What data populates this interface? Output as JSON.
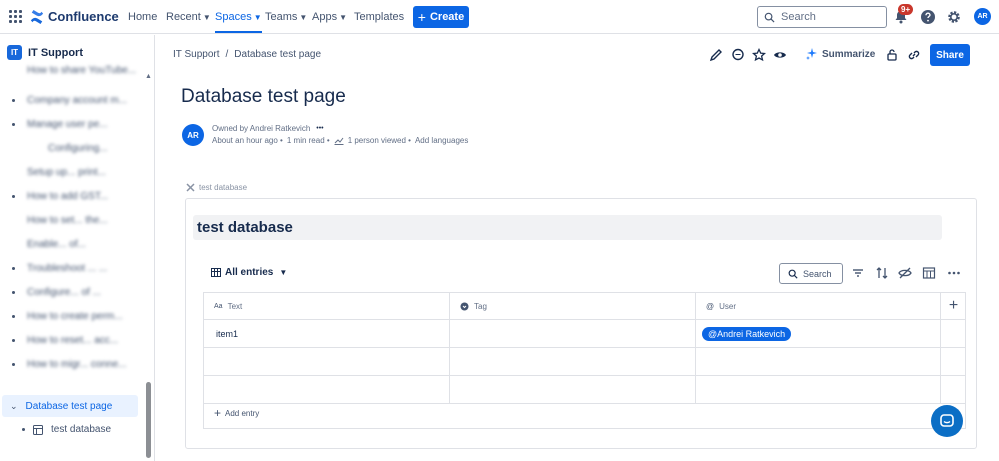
{
  "topnav": {
    "product": "Confluence",
    "items": [
      {
        "label": "Home",
        "has_chevron": false
      },
      {
        "label": "Recent",
        "has_chevron": true
      },
      {
        "label": "Spaces",
        "has_chevron": true,
        "active": true
      },
      {
        "label": "Teams",
        "has_chevron": true
      },
      {
        "label": "Apps",
        "has_chevron": true
      },
      {
        "label": "Templates",
        "has_chevron": false
      }
    ],
    "create_label": "Create",
    "search_placeholder": "Search",
    "notifications_badge": "9+",
    "user_initials": "AR"
  },
  "sidebar": {
    "space_icon": "IT",
    "space_name": "IT Support",
    "blurred_items": [
      "How to share YouTube...",
      "Company account m...",
      "Manage user pe...",
      "Configuring...",
      "Setup up... print...",
      "How to add GST...",
      "How to set... the...",
      "Enable... of...",
      "Troubleshoot ... ...",
      "Configure... of ...",
      "How to create perm...",
      "How to reset... acc...",
      "How to migr... conne..."
    ],
    "active_item": "Database test page",
    "child_item": "test database"
  },
  "breadcrumb": {
    "space": "IT Support",
    "separator": "/",
    "page": "Database test page"
  },
  "page_actions": {
    "summarize_label": "Summarize",
    "share_label": "Share"
  },
  "page": {
    "title": "Database test page",
    "author_initials": "AR",
    "owned_by": "Owned by Andrei Ratkevich",
    "more": "•••",
    "updated": "About an hour ago •",
    "read_time": "1 min read •",
    "views": "1 person viewed •",
    "add_languages": "Add languages"
  },
  "database": {
    "link_label": "test database",
    "title": "test database",
    "view_label": "All entries",
    "search_label": "Search",
    "columns": [
      {
        "label": "Text",
        "icon": "Aa"
      },
      {
        "label": "Tag",
        "icon": "tag-icon"
      },
      {
        "label": "User",
        "icon": "@"
      }
    ],
    "rows": [
      {
        "text": "item1",
        "tag": "",
        "user": "@Andrei Ratkevich"
      },
      {
        "text": "",
        "tag": "",
        "user": ""
      },
      {
        "text": "",
        "tag": "",
        "user": ""
      }
    ],
    "add_entry_label": "Add entry"
  },
  "colors": {
    "accent": "#0c66e4",
    "text": "#172b4d",
    "subtle": "#44546f",
    "border": "#dfe1e6"
  }
}
